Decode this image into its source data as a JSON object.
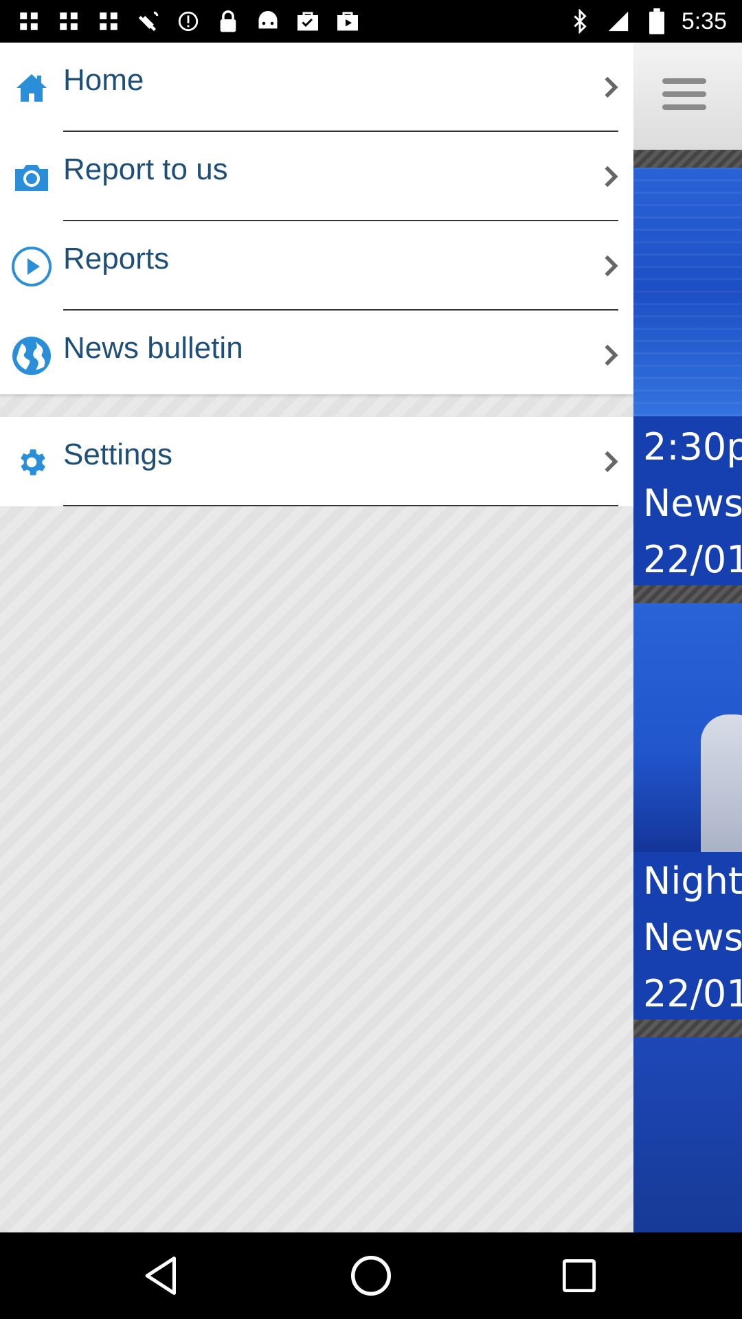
{
  "status_bar": {
    "time": "5:35",
    "left_icons": [
      "photo-icon",
      "photo-icon",
      "photo-icon",
      "satellite-fake-gps-icon",
      "alert-circle-icon",
      "lock-icon",
      "android-icon",
      "check-bag-icon",
      "play-bag-icon"
    ],
    "right_icons": [
      "bluetooth-icon",
      "signal-icon",
      "battery-icon"
    ]
  },
  "drawer": {
    "items": [
      {
        "label": "Home",
        "icon": "home-icon"
      },
      {
        "label": "Report to us",
        "icon": "camera-icon"
      },
      {
        "label": "Reports",
        "icon": "play-icon"
      },
      {
        "label": "News bulletin",
        "icon": "globe-icon"
      }
    ],
    "settings": {
      "label": "Settings",
      "icon": "gear-icon"
    },
    "accent_color": "#2a8fd8",
    "label_color": "#1e4f7a"
  },
  "content": {
    "cards": [
      {
        "line1": "2:30p",
        "line2": "News",
        "line3": "22/01"
      },
      {
        "line1": "Night",
        "line2": "News",
        "line3": "22/01"
      }
    ]
  },
  "nav_bar": {
    "buttons": [
      "back-icon",
      "home-circle-icon",
      "recents-icon"
    ]
  }
}
